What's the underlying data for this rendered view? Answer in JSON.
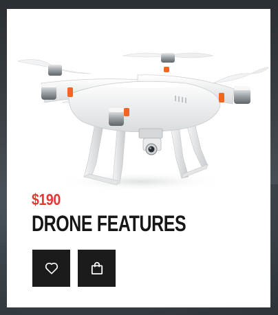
{
  "product": {
    "price": "$190",
    "title": "DRONE FEATURES",
    "image_name": "quadcopter-drone-with-camera"
  },
  "actions": [
    {
      "name": "wishlist",
      "icon": "heart-icon"
    },
    {
      "name": "add-to-cart",
      "icon": "shopping-bag-icon"
    }
  ],
  "colors": {
    "price": "#e53935",
    "title": "#161616",
    "button_bg": "#1b1b1b",
    "accent_orange": "#f26522"
  }
}
